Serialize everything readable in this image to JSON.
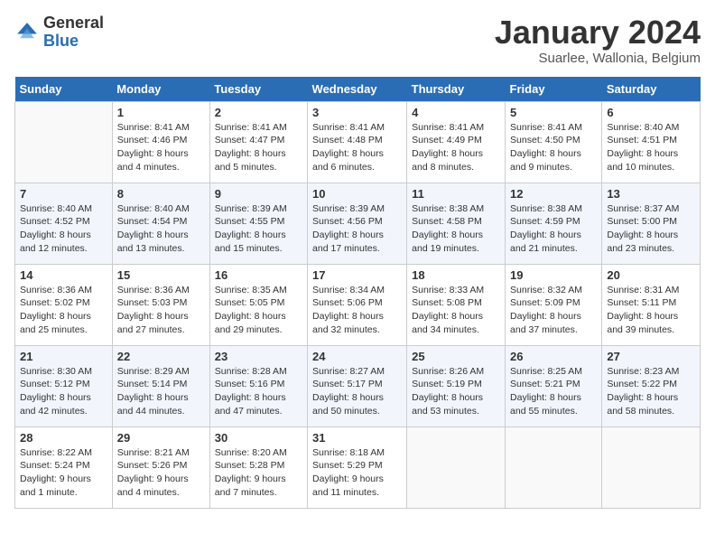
{
  "header": {
    "logo_general": "General",
    "logo_blue": "Blue",
    "month_title": "January 2024",
    "subtitle": "Suarlee, Wallonia, Belgium"
  },
  "days_of_week": [
    "Sunday",
    "Monday",
    "Tuesday",
    "Wednesday",
    "Thursday",
    "Friday",
    "Saturday"
  ],
  "weeks": [
    [
      {
        "day": "",
        "info": ""
      },
      {
        "day": "1",
        "info": "Sunrise: 8:41 AM\nSunset: 4:46 PM\nDaylight: 8 hours\nand 4 minutes."
      },
      {
        "day": "2",
        "info": "Sunrise: 8:41 AM\nSunset: 4:47 PM\nDaylight: 8 hours\nand 5 minutes."
      },
      {
        "day": "3",
        "info": "Sunrise: 8:41 AM\nSunset: 4:48 PM\nDaylight: 8 hours\nand 6 minutes."
      },
      {
        "day": "4",
        "info": "Sunrise: 8:41 AM\nSunset: 4:49 PM\nDaylight: 8 hours\nand 8 minutes."
      },
      {
        "day": "5",
        "info": "Sunrise: 8:41 AM\nSunset: 4:50 PM\nDaylight: 8 hours\nand 9 minutes."
      },
      {
        "day": "6",
        "info": "Sunrise: 8:40 AM\nSunset: 4:51 PM\nDaylight: 8 hours\nand 10 minutes."
      }
    ],
    [
      {
        "day": "7",
        "info": "Sunrise: 8:40 AM\nSunset: 4:52 PM\nDaylight: 8 hours\nand 12 minutes."
      },
      {
        "day": "8",
        "info": "Sunrise: 8:40 AM\nSunset: 4:54 PM\nDaylight: 8 hours\nand 13 minutes."
      },
      {
        "day": "9",
        "info": "Sunrise: 8:39 AM\nSunset: 4:55 PM\nDaylight: 8 hours\nand 15 minutes."
      },
      {
        "day": "10",
        "info": "Sunrise: 8:39 AM\nSunset: 4:56 PM\nDaylight: 8 hours\nand 17 minutes."
      },
      {
        "day": "11",
        "info": "Sunrise: 8:38 AM\nSunset: 4:58 PM\nDaylight: 8 hours\nand 19 minutes."
      },
      {
        "day": "12",
        "info": "Sunrise: 8:38 AM\nSunset: 4:59 PM\nDaylight: 8 hours\nand 21 minutes."
      },
      {
        "day": "13",
        "info": "Sunrise: 8:37 AM\nSunset: 5:00 PM\nDaylight: 8 hours\nand 23 minutes."
      }
    ],
    [
      {
        "day": "14",
        "info": "Sunrise: 8:36 AM\nSunset: 5:02 PM\nDaylight: 8 hours\nand 25 minutes."
      },
      {
        "day": "15",
        "info": "Sunrise: 8:36 AM\nSunset: 5:03 PM\nDaylight: 8 hours\nand 27 minutes."
      },
      {
        "day": "16",
        "info": "Sunrise: 8:35 AM\nSunset: 5:05 PM\nDaylight: 8 hours\nand 29 minutes."
      },
      {
        "day": "17",
        "info": "Sunrise: 8:34 AM\nSunset: 5:06 PM\nDaylight: 8 hours\nand 32 minutes."
      },
      {
        "day": "18",
        "info": "Sunrise: 8:33 AM\nSunset: 5:08 PM\nDaylight: 8 hours\nand 34 minutes."
      },
      {
        "day": "19",
        "info": "Sunrise: 8:32 AM\nSunset: 5:09 PM\nDaylight: 8 hours\nand 37 minutes."
      },
      {
        "day": "20",
        "info": "Sunrise: 8:31 AM\nSunset: 5:11 PM\nDaylight: 8 hours\nand 39 minutes."
      }
    ],
    [
      {
        "day": "21",
        "info": "Sunrise: 8:30 AM\nSunset: 5:12 PM\nDaylight: 8 hours\nand 42 minutes."
      },
      {
        "day": "22",
        "info": "Sunrise: 8:29 AM\nSunset: 5:14 PM\nDaylight: 8 hours\nand 44 minutes."
      },
      {
        "day": "23",
        "info": "Sunrise: 8:28 AM\nSunset: 5:16 PM\nDaylight: 8 hours\nand 47 minutes."
      },
      {
        "day": "24",
        "info": "Sunrise: 8:27 AM\nSunset: 5:17 PM\nDaylight: 8 hours\nand 50 minutes."
      },
      {
        "day": "25",
        "info": "Sunrise: 8:26 AM\nSunset: 5:19 PM\nDaylight: 8 hours\nand 53 minutes."
      },
      {
        "day": "26",
        "info": "Sunrise: 8:25 AM\nSunset: 5:21 PM\nDaylight: 8 hours\nand 55 minutes."
      },
      {
        "day": "27",
        "info": "Sunrise: 8:23 AM\nSunset: 5:22 PM\nDaylight: 8 hours\nand 58 minutes."
      }
    ],
    [
      {
        "day": "28",
        "info": "Sunrise: 8:22 AM\nSunset: 5:24 PM\nDaylight: 9 hours\nand 1 minute."
      },
      {
        "day": "29",
        "info": "Sunrise: 8:21 AM\nSunset: 5:26 PM\nDaylight: 9 hours\nand 4 minutes."
      },
      {
        "day": "30",
        "info": "Sunrise: 8:20 AM\nSunset: 5:28 PM\nDaylight: 9 hours\nand 7 minutes."
      },
      {
        "day": "31",
        "info": "Sunrise: 8:18 AM\nSunset: 5:29 PM\nDaylight: 9 hours\nand 11 minutes."
      },
      {
        "day": "",
        "info": ""
      },
      {
        "day": "",
        "info": ""
      },
      {
        "day": "",
        "info": ""
      }
    ]
  ]
}
